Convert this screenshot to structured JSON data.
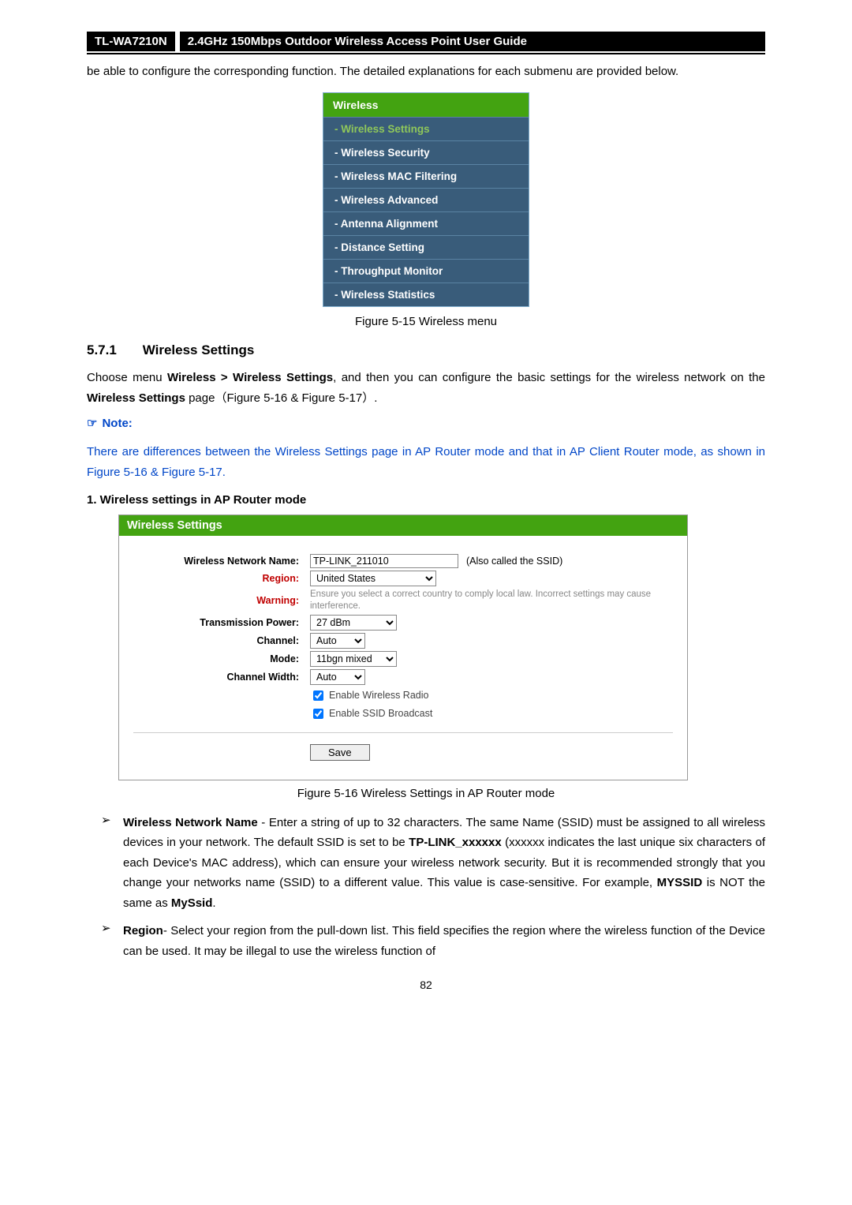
{
  "header": {
    "model": "TL-WA7210N",
    "title": "2.4GHz 150Mbps Outdoor Wireless Access Point User Guide"
  },
  "intro": "be able to configure the corresponding function. The detailed explanations for each submenu are provided below.",
  "menu": {
    "header": "Wireless",
    "items": [
      "- Wireless Settings",
      "- Wireless Security",
      "- Wireless MAC Filtering",
      "- Wireless Advanced",
      "- Antenna Alignment",
      "- Distance Setting",
      "- Throughput Monitor",
      "- Wireless Statistics"
    ]
  },
  "fig15": "Figure 5-15 Wireless menu",
  "section": {
    "num": "5.7.1",
    "title": "Wireless Settings"
  },
  "para_choose_pre": "Choose menu ",
  "para_choose_bold": "Wireless > Wireless Settings",
  "para_choose_mid": ", and then you can configure the basic settings for the wireless network on the ",
  "para_choose_bold2": "Wireless Settings",
  "para_choose_end": " page（Figure 5-16 & Figure 5-17）.",
  "note_label": "Note:",
  "note_body": "There are differences between the Wireless Settings page in AP Router mode and that in AP Client Router mode, as shown in Figure 5-16 & Figure 5-17.",
  "numlist": "1.   Wireless settings in AP Router mode",
  "panel": {
    "title": "Wireless Settings",
    "labels": {
      "name": "Wireless Network Name:",
      "region": "Region:",
      "warning": "Warning:",
      "tx": "Transmission Power:",
      "channel": "Channel:",
      "mode": "Mode:",
      "chwidth": "Channel Width:"
    },
    "values": {
      "name": "TP-LINK_211010",
      "ssid_note": "(Also called the SSID)",
      "region": "United States",
      "warning": "Ensure you select a correct country to comply local law. Incorrect settings may cause interference.",
      "tx": "27 dBm",
      "channel": "Auto",
      "mode": "11bgn mixed",
      "chwidth": "Auto",
      "chk1": "Enable Wireless Radio",
      "chk2": "Enable SSID Broadcast",
      "save": "Save"
    }
  },
  "fig16": "Figure 5-16   Wireless Settings in AP Router mode",
  "bullets": [
    {
      "leadBold": "Wireless Network Name",
      "text": " - Enter a string of up to 32 characters. The same Name (SSID) must be assigned to all wireless devices in your network. The default SSID is set to be ",
      "bold2": "TP-LINK_xxxxxx",
      "text2": " (xxxxxx indicates the last unique six characters of each Device's MAC address), which can ensure your wireless network security. But it is recommended strongly that you change your networks name (SSID) to a different value. This value is case-sensitive. For example, ",
      "bold3": "MYSSID",
      "text3": " is NOT the same as ",
      "bold4": "MySsid",
      "text4": "."
    },
    {
      "leadBold": "Region",
      "text": "- Select your region from the pull-down list. This field specifies the region where the wireless function of the Device can be used. It may be illegal to use the wireless  function  of"
    }
  ],
  "pgnum": "82"
}
